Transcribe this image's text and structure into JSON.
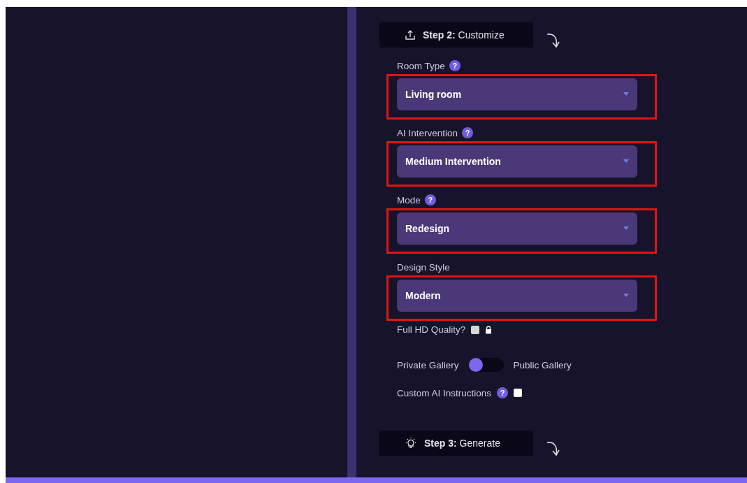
{
  "step2": {
    "title": "**Step 2:** Customize"
  },
  "fields": [
    {
      "label": "Room Type",
      "help": "?",
      "value": "Living room",
      "highlighted": true
    },
    {
      "label": "AI Intervention",
      "help": "?",
      "value": "Medium Intervention",
      "highlighted": true
    },
    {
      "label": "Mode",
      "help": "?",
      "value": "Redesign",
      "highlighted": true
    },
    {
      "label": "Design Style",
      "value": "Modern",
      "highlighted": true
    }
  ],
  "full_hd": {
    "label": "Full HD Quality?",
    "checked": false,
    "locked": true
  },
  "gallery": {
    "left": "Private Gallery",
    "right": "Public Gallery",
    "on": false
  },
  "custom_ai": {
    "label": "Custom AI Instructions",
    "help": "?",
    "checked": false
  },
  "step3": {
    "title": "**Step 3:** Generate"
  }
}
